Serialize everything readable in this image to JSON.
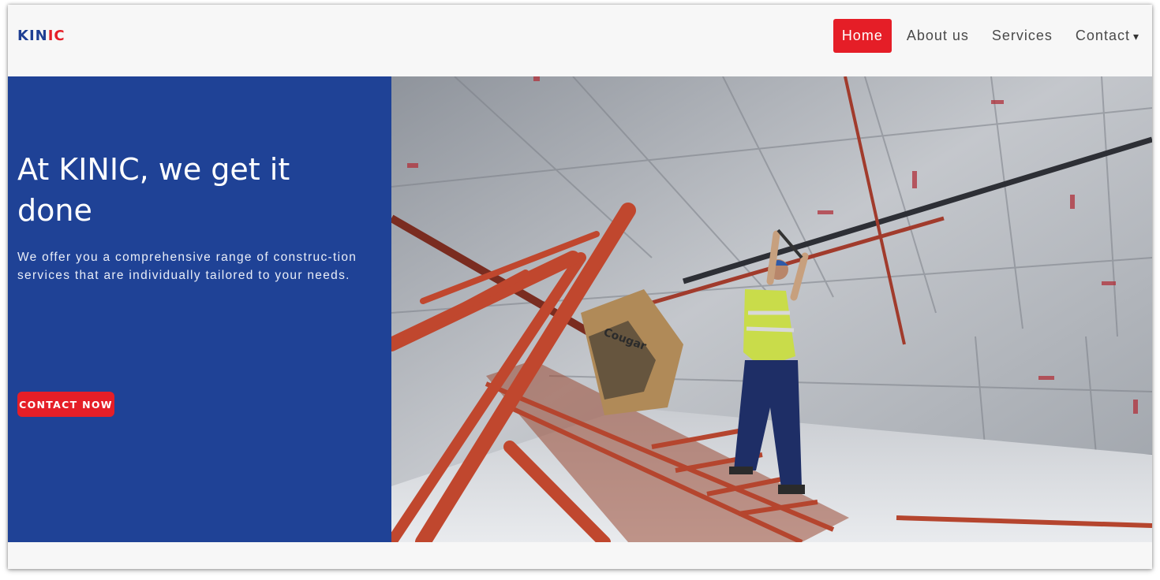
{
  "brand": {
    "logo_part1": "KIN",
    "logo_part2": "IC",
    "primary_color": "#1f4296",
    "accent_color": "#e51e27"
  },
  "nav": {
    "items": [
      {
        "label": "Home",
        "active": true
      },
      {
        "label": "About us",
        "active": false
      },
      {
        "label": "Services",
        "active": false
      },
      {
        "label": "Contact",
        "active": false,
        "dropdown_icon": "caret-down-icon"
      }
    ],
    "contact_caret": "▾"
  },
  "hero": {
    "title": "At KINIC, we get it done",
    "text": "We offer you a comprehensive range of construc-tion services that are individually tailored to your needs.",
    "cta_label": "CONTACT NOW",
    "photo_box_label": "Cougar"
  }
}
